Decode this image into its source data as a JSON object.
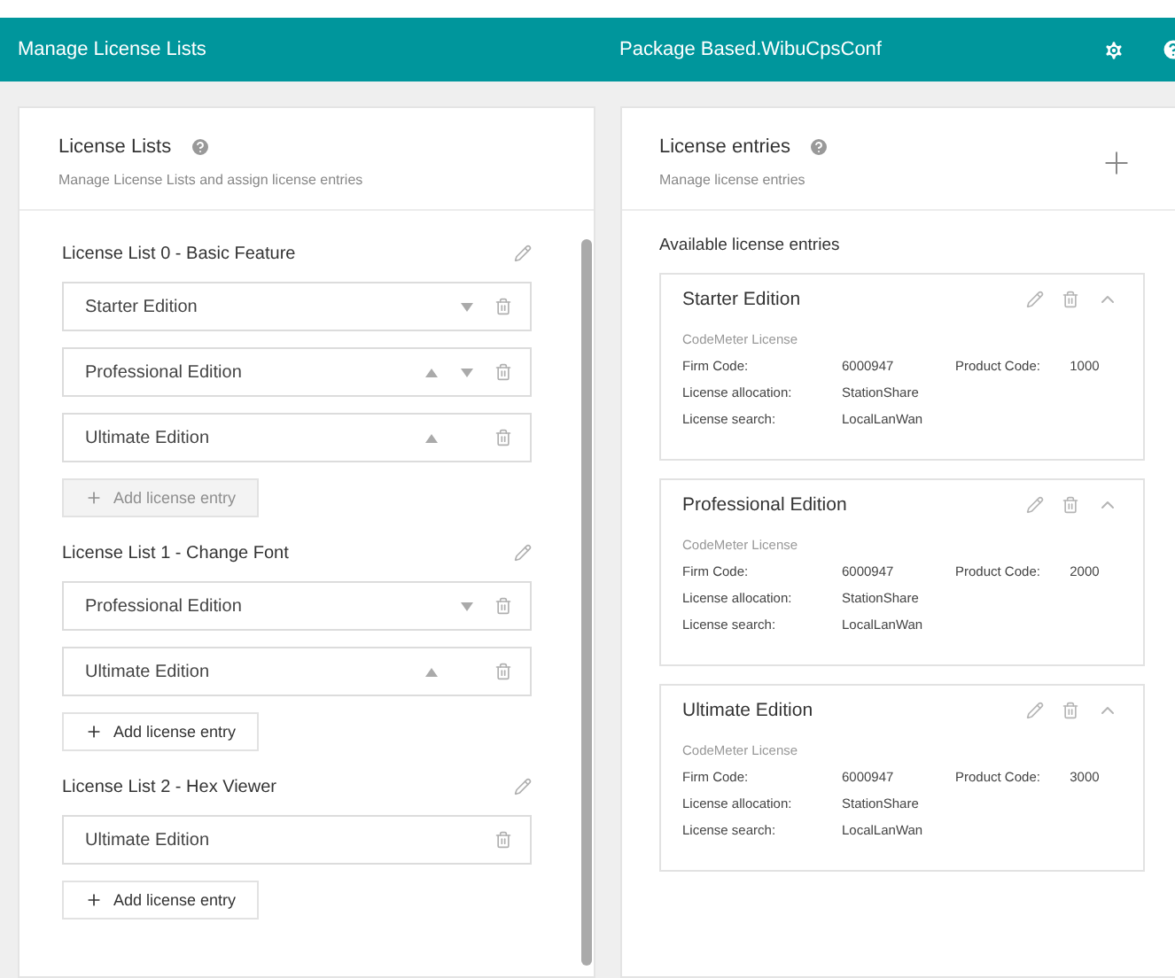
{
  "header": {
    "title": "Manage License Lists",
    "package": "Package Based.WibuCpsConf"
  },
  "license_lists_panel": {
    "title": "License Lists",
    "subtitle": "Manage License Lists and assign license entries",
    "lists": [
      {
        "name": "License List 0 - Basic Feature",
        "entries": [
          {
            "name": "Starter Edition",
            "can_move_up": false,
            "can_move_down": true
          },
          {
            "name": "Professional Edition",
            "can_move_up": true,
            "can_move_down": true
          },
          {
            "name": "Ultimate Edition",
            "can_move_up": true,
            "can_move_down": false
          }
        ],
        "add_button": {
          "label": "Add license entry",
          "disabled": true
        }
      },
      {
        "name": "License List 1 - Change Font",
        "entries": [
          {
            "name": "Professional Edition",
            "can_move_up": false,
            "can_move_down": true
          },
          {
            "name": "Ultimate Edition",
            "can_move_up": true,
            "can_move_down": false
          }
        ],
        "add_button": {
          "label": "Add license entry",
          "disabled": false
        }
      },
      {
        "name": "License List 2 - Hex Viewer",
        "entries": [
          {
            "name": "Ultimate Edition",
            "can_move_up": false,
            "can_move_down": false
          }
        ],
        "add_button": {
          "label": "Add license entry",
          "disabled": false
        }
      }
    ]
  },
  "license_entries_panel": {
    "title": "License entries",
    "subtitle": "Manage license entries",
    "section_title": "Available license entries",
    "entries": [
      {
        "name": "Starter Edition",
        "type": "CodeMeter License",
        "firm_code_label": "Firm Code:",
        "firm_code": "6000947",
        "product_code_label": "Product Code:",
        "product_code": "1000",
        "allocation_label": "License allocation:",
        "allocation": "StationShare",
        "search_label": "License search:",
        "search": "LocalLanWan"
      },
      {
        "name": "Professional Edition",
        "type": "CodeMeter License",
        "firm_code_label": "Firm Code:",
        "firm_code": "6000947",
        "product_code_label": "Product Code:",
        "product_code": "2000",
        "allocation_label": "License allocation:",
        "allocation": "StationShare",
        "search_label": "License search:",
        "search": "LocalLanWan"
      },
      {
        "name": "Ultimate Edition",
        "type": "CodeMeter License",
        "firm_code_label": "Firm Code:",
        "firm_code": "6000947",
        "product_code_label": "Product Code:",
        "product_code": "3000",
        "allocation_label": "License allocation:",
        "allocation": "StationShare",
        "search_label": "License search:",
        "search": "LocalLanWan"
      }
    ]
  }
}
